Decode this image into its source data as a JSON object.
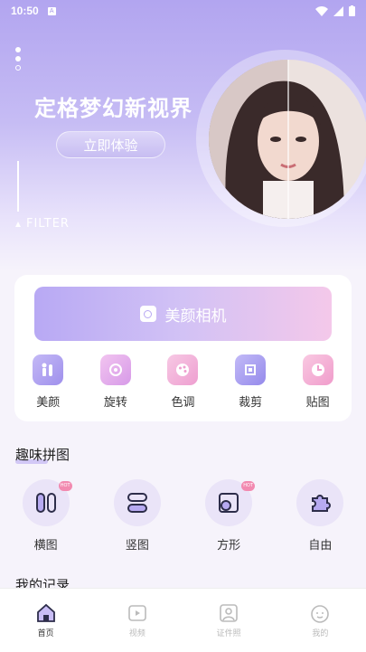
{
  "status": {
    "time": "10:50"
  },
  "hero": {
    "title": "定格梦幻新视界",
    "cta_label": "立即体验",
    "filter_label": "FILTER"
  },
  "camera": {
    "label": "美颜相机"
  },
  "tools": [
    {
      "label": "美颜",
      "icon": "beauty-icon",
      "color": "#a898ee"
    },
    {
      "label": "旋转",
      "icon": "rotate-icon",
      "color": "#e7a9e9"
    },
    {
      "label": "色调",
      "icon": "palette-icon",
      "color": "#f0a9d8"
    },
    {
      "label": "裁剪",
      "icon": "crop-icon",
      "color": "#a89ef0"
    },
    {
      "label": "贴图",
      "icon": "sticker-icon",
      "color": "#f4a6d2"
    }
  ],
  "fun_collage": {
    "title": "趣味拼图",
    "items": [
      {
        "label": "横图",
        "icon": "horizontal-collage-icon",
        "hot": true
      },
      {
        "label": "竖图",
        "icon": "vertical-collage-icon",
        "hot": false
      },
      {
        "label": "方形",
        "icon": "square-collage-icon",
        "hot": true
      },
      {
        "label": "自由",
        "icon": "puzzle-icon",
        "hot": false
      }
    ],
    "hot_badge": "HOT"
  },
  "records": {
    "title": "我的记录"
  },
  "tabbar": [
    {
      "label": "首页",
      "icon": "home-icon",
      "active": true
    },
    {
      "label": "视频",
      "icon": "video-icon",
      "active": false
    },
    {
      "label": "证件照",
      "icon": "id-photo-icon",
      "active": false
    },
    {
      "label": "我的",
      "icon": "profile-icon",
      "active": false
    }
  ],
  "colors": {
    "accent": "#a898ee",
    "hero_top": "#b2a5f0"
  }
}
